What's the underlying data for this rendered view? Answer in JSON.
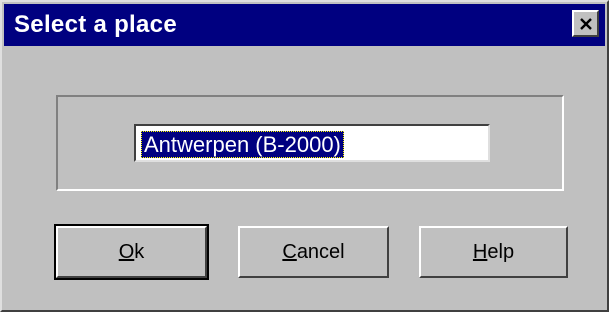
{
  "window": {
    "title": "Select a place",
    "title_bar_color": "#000080",
    "background_color": "#c0c0c0"
  },
  "icons": {
    "close": "close-icon"
  },
  "place_field": {
    "value": "Antwerpen (B-2000)",
    "selected": true
  },
  "buttons": {
    "ok": {
      "accel": "O",
      "rest": "k",
      "default": true
    },
    "cancel": {
      "accel": "C",
      "rest": "ancel"
    },
    "help": {
      "accel": "H",
      "rest": "elp"
    }
  }
}
